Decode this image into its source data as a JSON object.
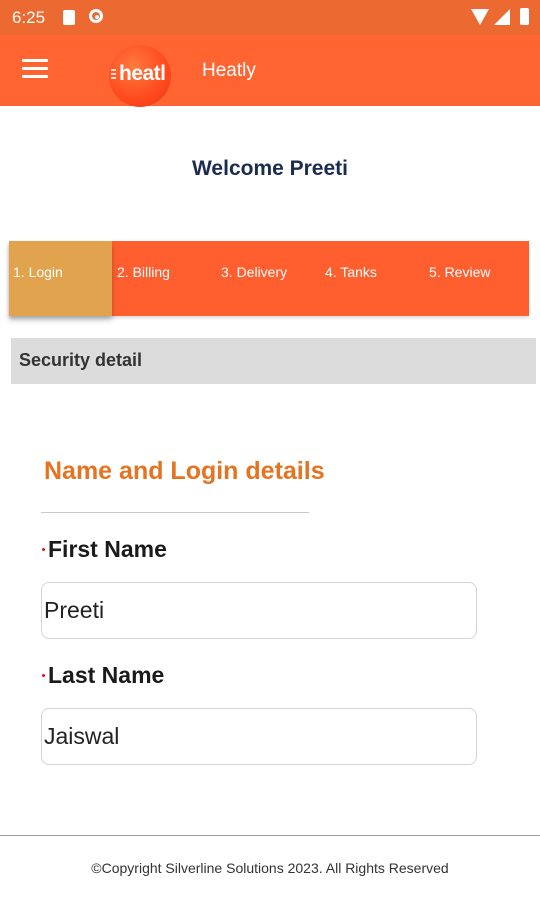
{
  "status_bar": {
    "time": "6:25"
  },
  "app_bar": {
    "logo_text": "heatl",
    "title": "Heatly"
  },
  "welcome": "Welcome Preeti",
  "steps": [
    {
      "label": "1. Login",
      "active": true
    },
    {
      "label": "2. Billing",
      "active": false
    },
    {
      "label": "3. Delivery",
      "active": false
    },
    {
      "label": "4. Tanks",
      "active": false
    },
    {
      "label": "5. Review",
      "active": false
    }
  ],
  "section_title": "Security detail",
  "form": {
    "heading": "Name and Login details",
    "first_name": {
      "label": "First Name",
      "value": "Preeti"
    },
    "last_name": {
      "label": "Last Name",
      "value": "Jaiswal"
    }
  },
  "footer": "©Copyright Silverline Solutions 2023. All Rights Reserved",
  "colors": {
    "app_bar": "#ff6431",
    "status_bar": "#ec6a32",
    "active_step": "#e1a34d",
    "heading": "#e5731f",
    "welcome": "#1b2b52",
    "required_marker": "#d41a1a"
  },
  "icons": [
    "sd-card-icon",
    "sync-icon",
    "wifi-icon",
    "signal-icon",
    "battery-icon",
    "menu-icon"
  ]
}
